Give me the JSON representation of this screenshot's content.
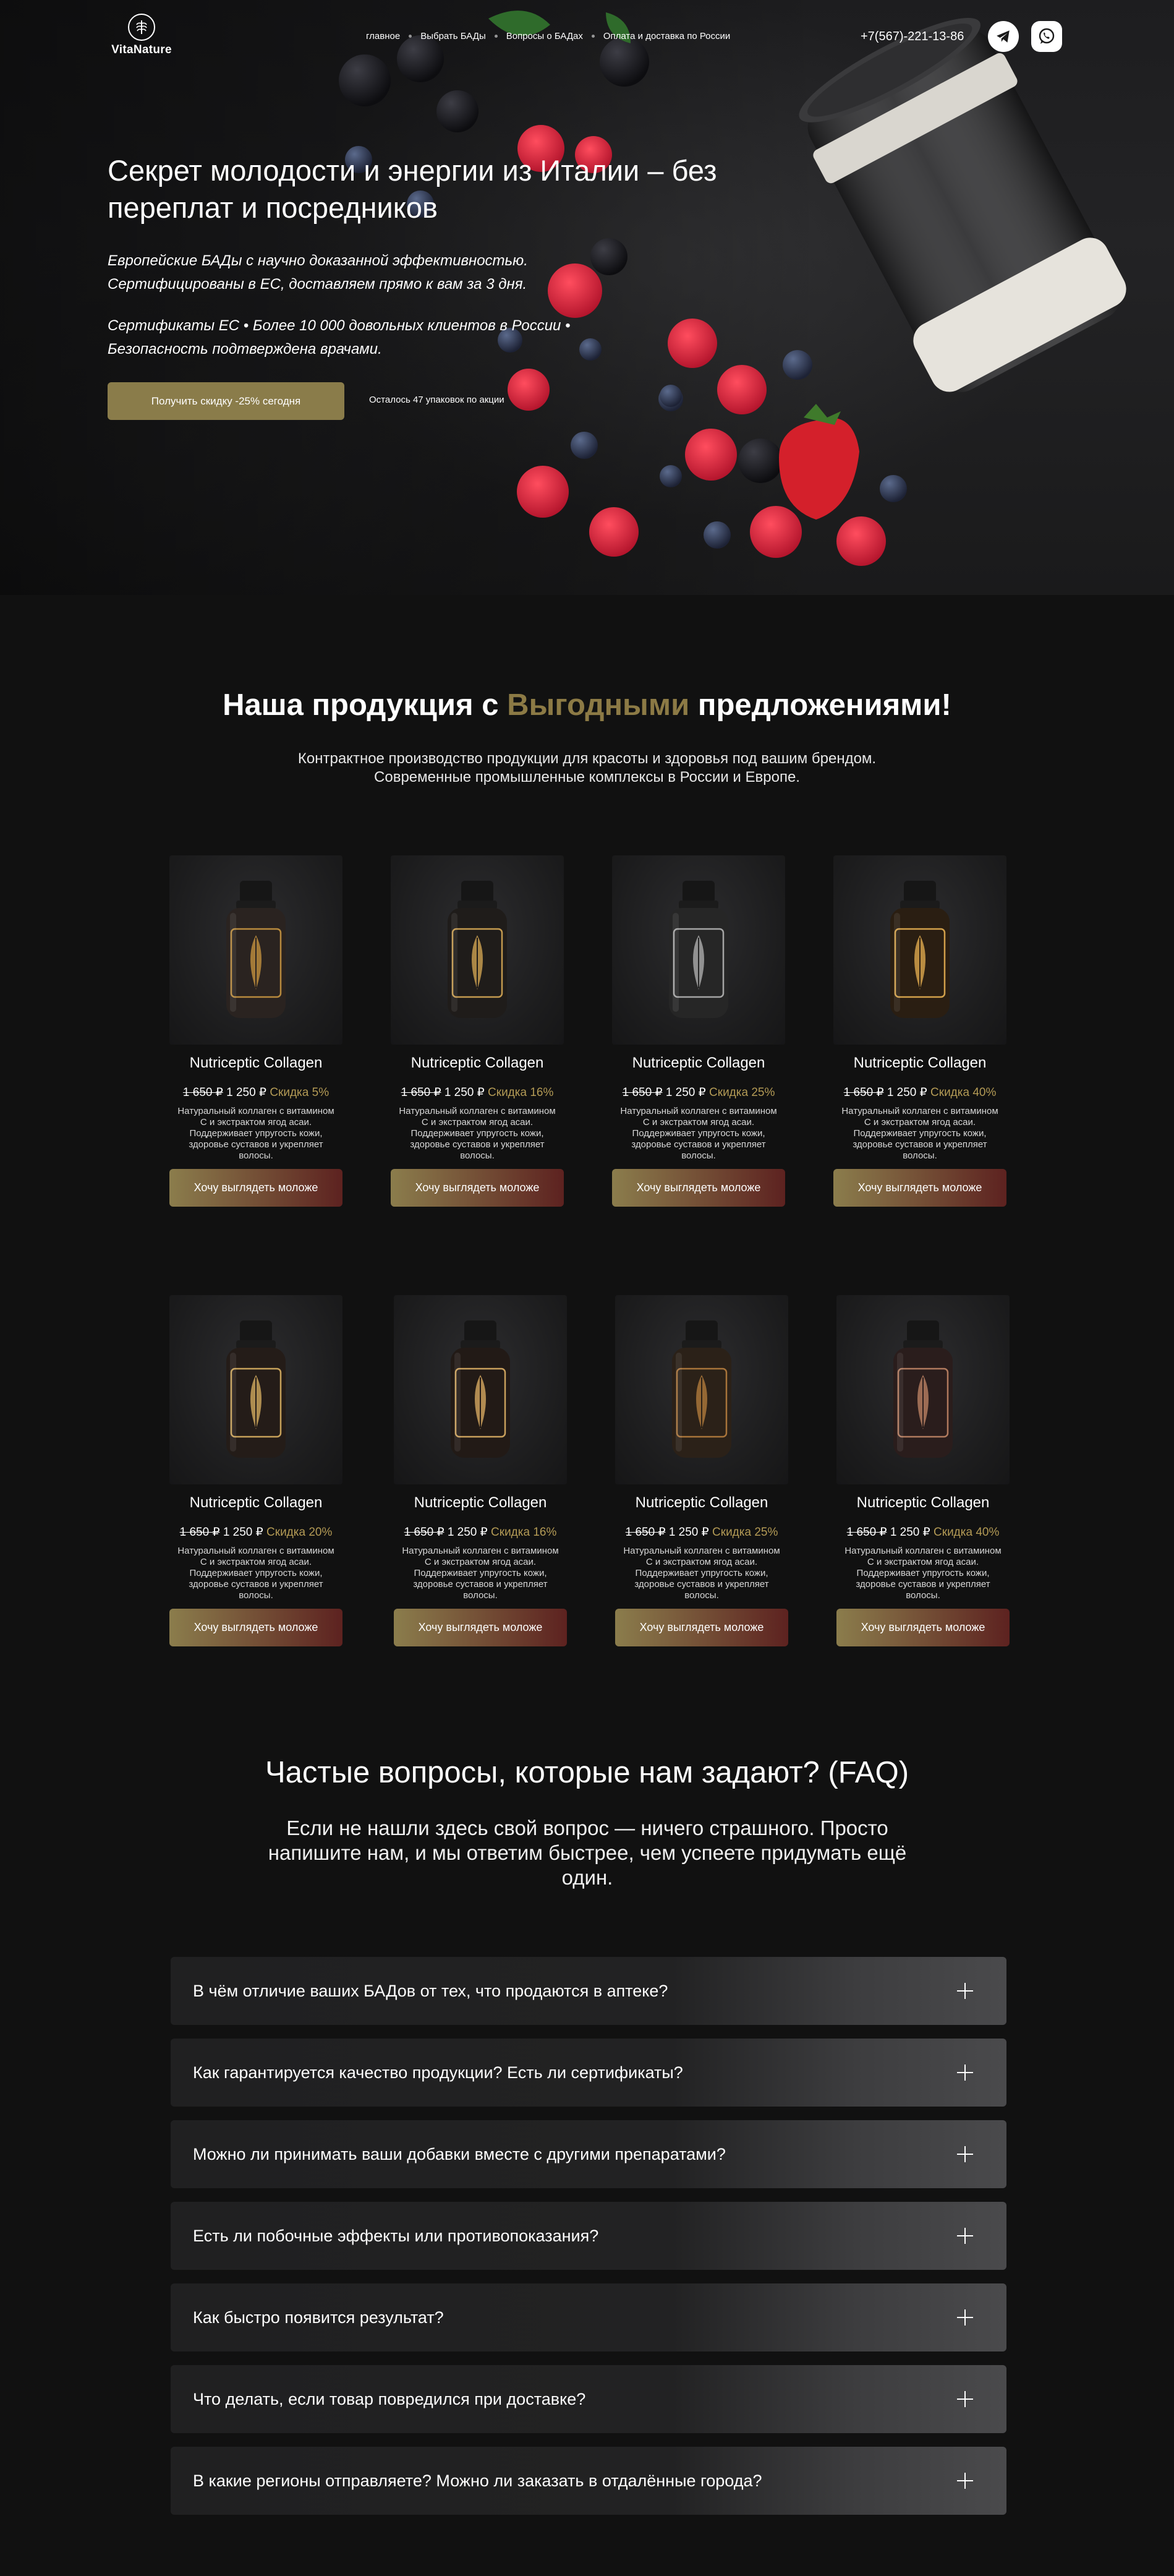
{
  "brand": {
    "name": "VitaNature"
  },
  "nav": {
    "items": [
      "главное",
      "Выбрать БАДы",
      "Вопросы о БАДах",
      "Оплата и доставка по России"
    ]
  },
  "contact": {
    "phone": "+7(567)-221-13-86"
  },
  "hero": {
    "title": "Секрет молодости и энергии из Италии – без переплат и посредников",
    "subtitle": "Европейские БАДы с научно доказанной эффективностью. Сертифицированы в ЕС, доставляем прямо к вам за 3 дня.",
    "trust": "Сертификаты ЕС • Более 10 000 довольных клиентов в России • Безопасность подтверждена врачами.",
    "cta": "Получить скидку -25% сегодня",
    "stock_note": "Осталось 47 упаковок по акции"
  },
  "products_section": {
    "title_start": "Наша продукция с ",
    "title_accent": "Выгодными",
    "title_end": " предложениями!",
    "description": "Контрактное производство продукции для красоты и здоровья под вашим брендом. Современные промышленные комплексы в России и Европе.",
    "items": [
      {
        "name": "Nutriceptic Collagen",
        "old_price": "1 650 ₽",
        "price": "1 250 ₽",
        "discount": "Скидка 5%",
        "text": "Натуральный коллаген с витамином С и экстрактом ягод асаи. Поддерживает упругость кожи, здоровье суставов и укрепляет волосы.",
        "button": "Хочу выглядеть моложе"
      },
      {
        "name": "Nutriceptic Collagen",
        "old_price": "1 650 ₽",
        "price": "1 250 ₽",
        "discount": "Скидка 16%",
        "text": "Натуральный коллаген с витамином С и экстрактом ягод асаи. Поддерживает упругость кожи, здоровье суставов и укрепляет волосы.",
        "button": "Хочу выглядеть моложе"
      },
      {
        "name": "Nutriceptic Collagen",
        "old_price": "1 650 ₽",
        "price": "1 250 ₽",
        "discount": "Скидка 25%",
        "text": "Натуральный коллаген с витамином С и экстрактом ягод асаи. Поддерживает упругость кожи, здоровье суставов и укрепляет волосы.",
        "button": "Хочу выглядеть моложе"
      },
      {
        "name": "Nutriceptic Collagen",
        "old_price": "1 650 ₽",
        "price": "1 250 ₽",
        "discount": "Скидка 40%",
        "text": "Натуральный коллаген с витамином С и экстрактом ягод асаи. Поддерживает упругость кожи, здоровье суставов и укрепляет волосы.",
        "button": "Хочу выглядеть моложе"
      },
      {
        "name": "Nutriceptic Collagen",
        "old_price": "1 650 ₽",
        "price": "1 250 ₽",
        "discount": "Скидка  20%",
        "text": "Натуральный коллаген с витамином С и экстрактом ягод асаи. Поддерживает упругость кожи, здоровье суставов и укрепляет волосы.",
        "button": "Хочу выглядеть моложе"
      },
      {
        "name": "Nutriceptic Collagen",
        "old_price": "1 650 ₽",
        "price": "1 250 ₽",
        "discount": "Скидка 16%",
        "text": "Натуральный коллаген с витамином С и экстрактом ягод асаи. Поддерживает упругость кожи, здоровье суставов и укрепляет волосы.",
        "button": "Хочу выглядеть моложе"
      },
      {
        "name": "Nutriceptic Collagen",
        "old_price": "1 650 ₽",
        "price": "1 250 ₽",
        "discount": "Скидка 25%",
        "text": "Натуральный коллаген с витамином С и экстрактом ягод асаи. Поддерживает упругость кожи, здоровье суставов и укрепляет волосы.",
        "button": "Хочу выглядеть моложе"
      },
      {
        "name": "Nutriceptic Collagen",
        "old_price": "1 650 ₽",
        "price": "1 250 ₽",
        "discount": "Скидка 40%",
        "text": "Натуральный коллаген с витамином С и экстрактом ягод асаи. Поддерживает упругость кожи, здоровье суставов и укрепляет волосы.",
        "button": "Хочу выглядеть моложе"
      }
    ]
  },
  "faq": {
    "title": "Частые вопросы, которые нам задают? (FAQ)",
    "description": "Если не нашли здесь свой вопрос — ничего страшного. Просто напишите нам, и мы ответим быстрее, чем успеете придумать ещё один.",
    "items": [
      "В чём отличие ваших БАДов от тех, что продаются в аптеке?",
      "Как гарантируется качество продукции? Есть ли сертификаты?",
      "Можно ли принимать ваши добавки вместе с другими препаратами?",
      "Есть ли побочные эффекты или противопоказания?",
      "Как быстро появится результат?",
      "Что делать, если товар повредился при доставке?",
      "В какие регионы отправляете? Можно ли заказать в отдалённые города?"
    ]
  },
  "colors": {
    "accent_gold": "#8c7a45",
    "discount_gold": "#b39a55",
    "button_end": "#5d2220",
    "background": "#111111"
  },
  "icons": [
    "vita-leaf-icon",
    "telegram-icon",
    "whatsapp-icon",
    "plus-icon"
  ]
}
